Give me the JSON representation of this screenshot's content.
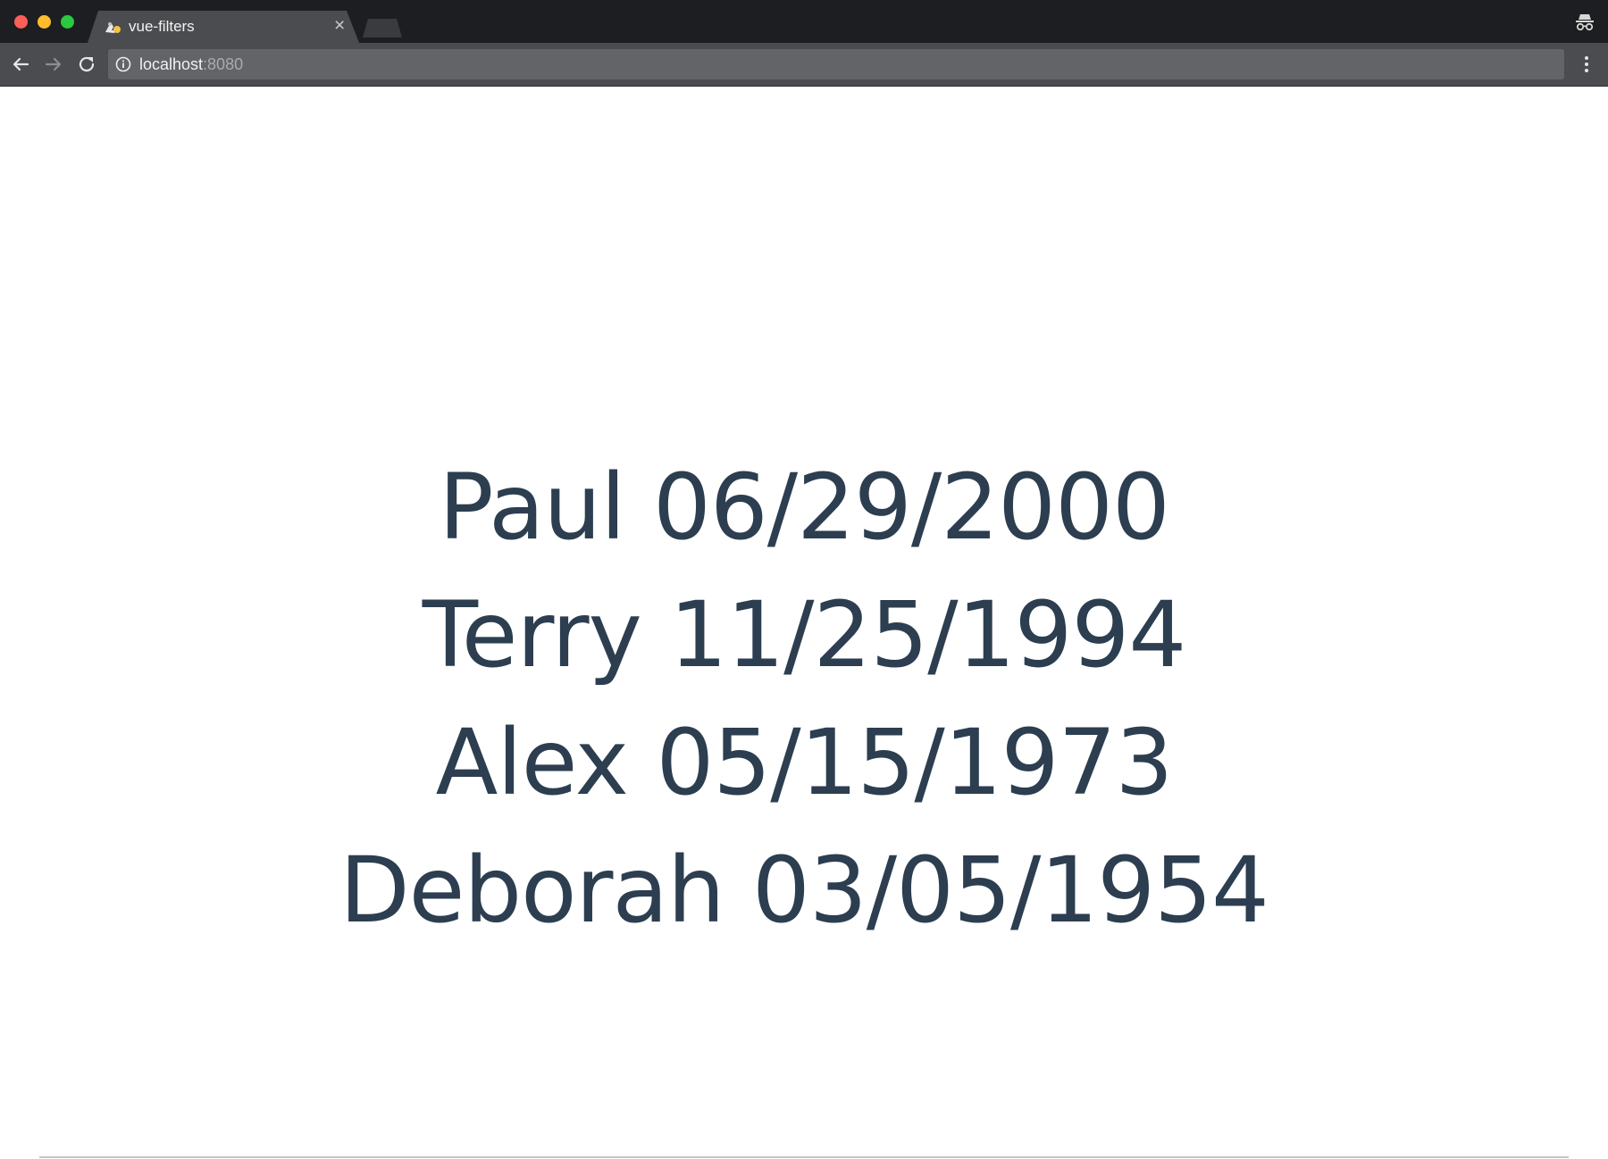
{
  "browser": {
    "tab_title": "vue-filters",
    "tab_close_glyph": "×",
    "url_host": "localhost",
    "url_port": ":8080",
    "icons": {
      "favicon": "vue-favicon-icon",
      "incognito": "incognito-icon",
      "back": "back-arrow-icon",
      "forward": "forward-arrow-icon",
      "reload": "reload-icon",
      "info": "info-icon",
      "zoom": "zoom-icon",
      "bookmark": "star-icon",
      "menu": "kebab-menu-icon"
    },
    "colors": {
      "titlebar": "#1d1e21",
      "toolbar": "#4b4c4f",
      "omnibox": "#636467"
    }
  },
  "page": {
    "text_color": "#2c3e50",
    "people": [
      {
        "name": "Paul",
        "date": "06/29/2000",
        "display": "Paul 06/29/2000"
      },
      {
        "name": "Terry",
        "date": "11/25/1994",
        "display": "Terry 11/25/1994"
      },
      {
        "name": "Alex",
        "date": "05/15/1973",
        "display": "Alex 05/15/1973"
      },
      {
        "name": "Deborah",
        "date": "03/05/1954",
        "display": "Deborah 03/05/1954"
      }
    ]
  }
}
